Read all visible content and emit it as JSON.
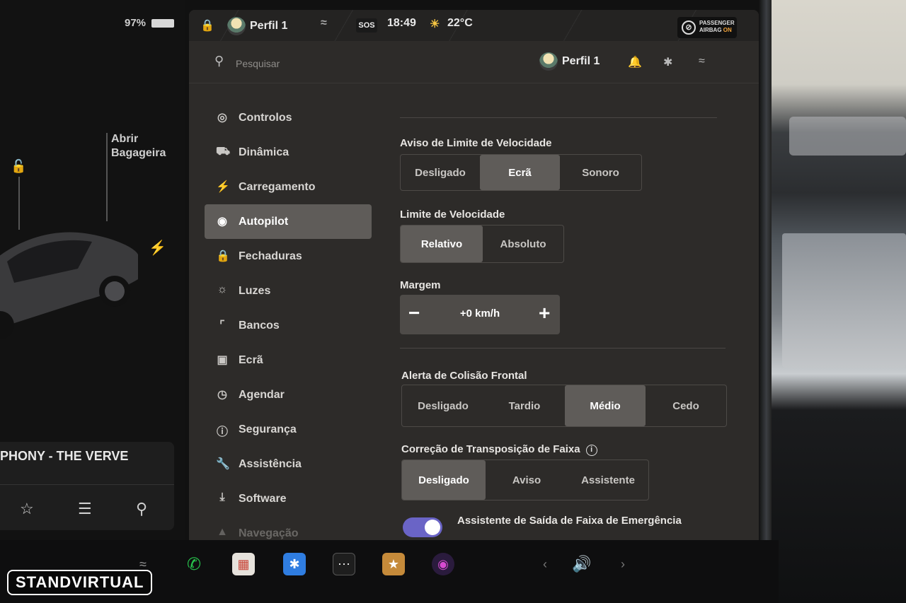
{
  "car_panel": {
    "battery": "97%",
    "trunk_line1": "Abrir",
    "trunk_line2": "Bagageira",
    "song": "PHONY - THE VERVE"
  },
  "statusbar": {
    "profile": "Perfil 1",
    "sos": "SOS",
    "time": "18:49",
    "temperature": "22°C",
    "airbag_line1": "PASSENGER",
    "airbag_line2": "AIRBAG",
    "airbag_state": "ON"
  },
  "header": {
    "search_placeholder": "Pesquisar",
    "profile": "Perfil 1"
  },
  "sidebar": {
    "items": [
      {
        "label": "Controlos"
      },
      {
        "label": "Dinâmica"
      },
      {
        "label": "Carregamento"
      },
      {
        "label": "Autopilot"
      },
      {
        "label": "Fechaduras"
      },
      {
        "label": "Luzes"
      },
      {
        "label": "Bancos"
      },
      {
        "label": "Ecrã"
      },
      {
        "label": "Agendar"
      },
      {
        "label": "Segurança"
      },
      {
        "label": "Assistência"
      },
      {
        "label": "Software"
      },
      {
        "label": "Navegação"
      }
    ],
    "active": "Autopilot"
  },
  "settings": {
    "speed_warning": {
      "label": "Aviso de Limite de Velocidade",
      "options": [
        "Desligado",
        "Ecrã",
        "Sonoro"
      ],
      "selected": "Ecrã"
    },
    "speed_limit": {
      "label": "Limite de Velocidade",
      "options": [
        "Relativo",
        "Absoluto"
      ],
      "selected": "Relativo"
    },
    "margin": {
      "label": "Margem",
      "value": "+0 km/h",
      "minus": "−",
      "plus": "+"
    },
    "collision": {
      "label": "Alerta de Colisão Frontal",
      "options": [
        "Desligado",
        "Tardio",
        "Médio",
        "Cedo"
      ],
      "selected": "Médio"
    },
    "lane_departure": {
      "label": "Correção de Transposição de Faixa",
      "options": [
        "Desligado",
        "Aviso",
        "Assistente"
      ],
      "selected": "Desligado"
    },
    "emergency_lane": {
      "label": "Assistente de Saída de Faixa de Emergência",
      "enabled": true
    }
  },
  "watermark": "STANDVIRTUAL",
  "colors": {
    "toggle_on": "#6a64c6",
    "selected_segment": "#5f5c59",
    "airbag_on": "#f2a33a"
  }
}
